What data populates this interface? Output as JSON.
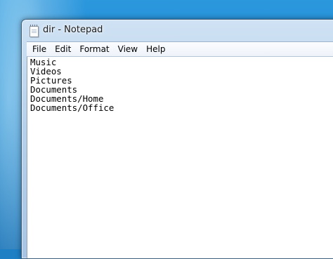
{
  "window": {
    "title": "dir - Notepad",
    "icon": "notepad-icon"
  },
  "menu": {
    "items": [
      "File",
      "Edit",
      "Format",
      "View",
      "Help"
    ]
  },
  "editor": {
    "text": "Music\nVideos\nPictures\nDocuments\nDocuments/Home\nDocuments/Office"
  }
}
